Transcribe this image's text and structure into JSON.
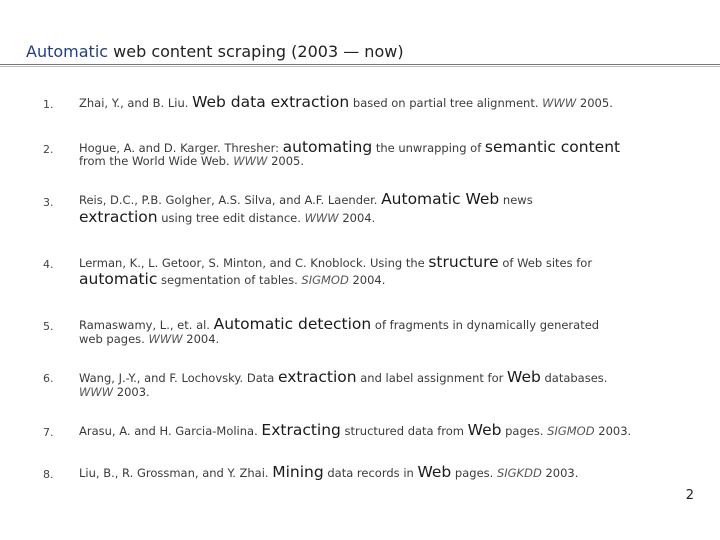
{
  "slide": {
    "title_highlight": "Automatic",
    "title_rest": " web content scraping (2003 — now)",
    "page_number": "2"
  },
  "refs": [
    {
      "num": "1.",
      "l1": [
        "Zhai, Y., and B. Liu. ",
        "Web data extraction",
        " based on partial tree alignment. ",
        "WWW",
        " 2005."
      ]
    },
    {
      "num": "2.",
      "l1": [
        "Hogue, A. and D. Karger. Thresher: ",
        "automating",
        " the unwrapping of ",
        "semantic content"
      ],
      "l2": [
        "from the World Wide Web. ",
        "WWW",
        " 2005."
      ]
    },
    {
      "num": "3.",
      "l1": [
        "Reis, D.C., P.B. Golgher, A.S. Silva, and A.F. Laender. ",
        "Automatic Web",
        " news"
      ],
      "l2": [
        "extraction",
        " using tree edit distance. ",
        "WWW",
        " 2004."
      ]
    },
    {
      "num": "4.",
      "l1": [
        "Lerman, K., L. Getoor, S. Minton, and C. Knoblock. Using the ",
        "structure",
        " of Web sites for"
      ],
      "l2": [
        "automatic",
        " segmentation of tables. ",
        "SIGMOD",
        " 2004."
      ]
    },
    {
      "num": "5.",
      "l1": [
        "Ramaswamy, L., et. al. ",
        "Automatic detection",
        " of fragments in dynamically generated"
      ],
      "l2": [
        "web pages. ",
        "WWW",
        " 2004."
      ]
    },
    {
      "num": "6.",
      "l1": [
        "Wang, J.-Y., and F. Lochovsky. Data ",
        "extraction",
        " and label assignment for ",
        "Web",
        " databases."
      ],
      "l2": [
        "WWW",
        " 2003."
      ]
    },
    {
      "num": "7.",
      "l1": [
        "Arasu, A. and H. Garcia-Molina. ",
        "Extracting",
        " structured data from ",
        "Web",
        " pages. ",
        "SIGMOD",
        " 2003."
      ]
    },
    {
      "num": "8.",
      "l1": [
        "Liu, B., R. Grossman, and Y. Zhai. ",
        "Mining",
        " data records in ",
        "Web",
        " pages. ",
        "SIGKDD",
        " 2003."
      ]
    }
  ]
}
